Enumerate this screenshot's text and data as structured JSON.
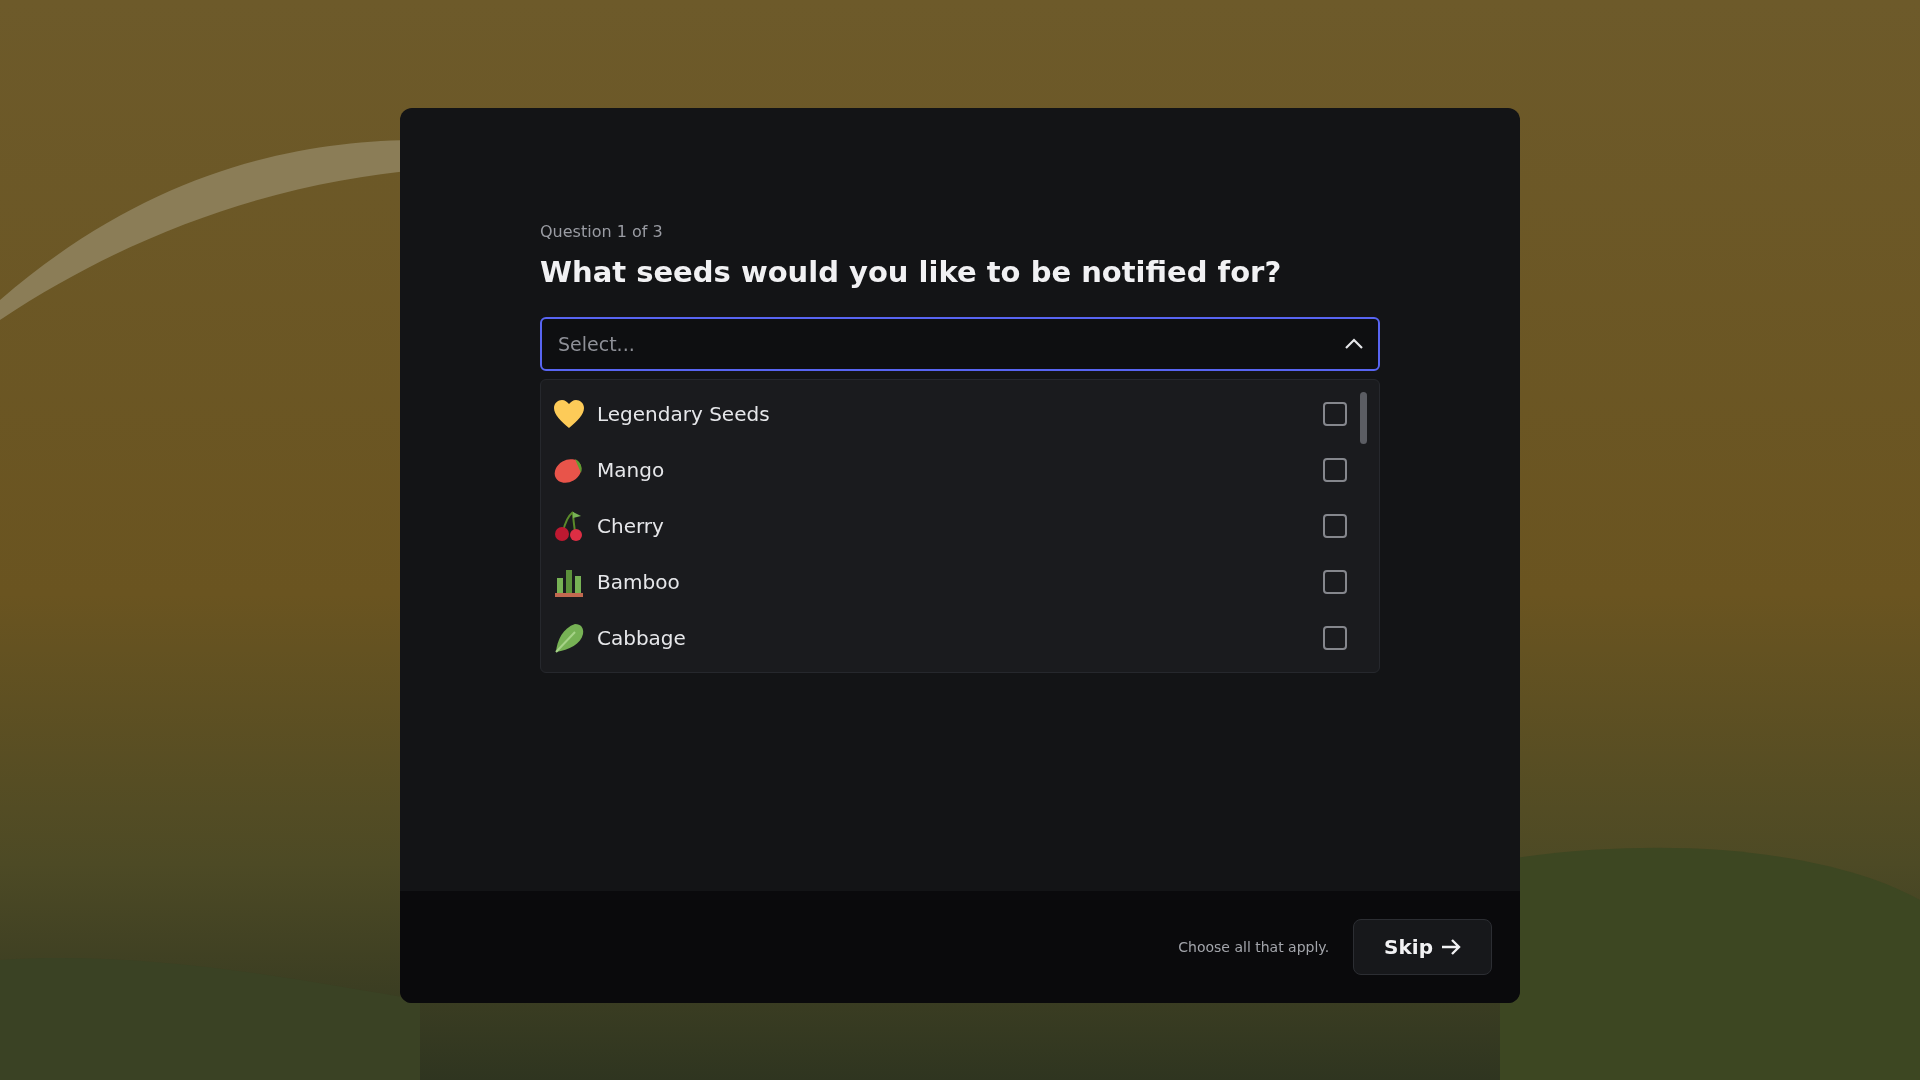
{
  "dialog": {
    "progress": "Question 1 of 3",
    "question": "What seeds would you like to be notified for?",
    "select": {
      "placeholder": "Select...",
      "expanded": true
    },
    "options": [
      {
        "label": "Legendary Seeds",
        "checked": false
      },
      {
        "label": "Mango",
        "checked": false
      },
      {
        "label": "Cherry",
        "checked": false
      },
      {
        "label": "Bamboo",
        "checked": false
      },
      {
        "label": "Cabbage",
        "checked": false
      }
    ],
    "footer": {
      "hint": "Choose all that apply.",
      "button": "Skip"
    }
  }
}
